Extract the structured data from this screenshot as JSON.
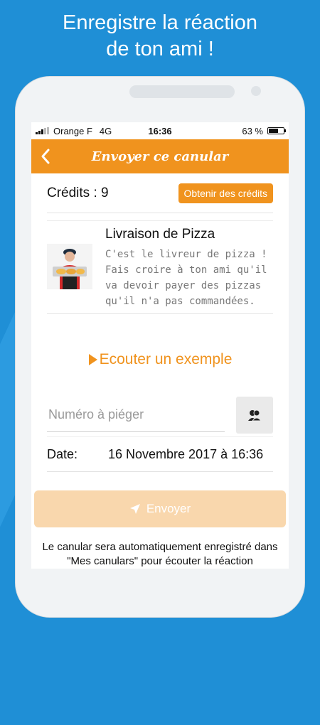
{
  "headline": {
    "line1": "Enregistre la réaction",
    "line2": "de ton ami !"
  },
  "status_bar": {
    "carrier": "Orange F",
    "network": "4G",
    "time": "16:36",
    "battery_text": "63 %",
    "battery_level": 0.63
  },
  "header": {
    "title": "Envoyer ce canular",
    "back_icon": "chevron-left-icon"
  },
  "credits": {
    "label": "Crédits : 9",
    "button_label": "Obtenir des crédits"
  },
  "prank": {
    "title": "Livraison de Pizza",
    "description": "C'est le livreur de pizza ! Fais croire à ton ami qu'il va devoir payer des pizzas qu'il n'a pas commandées.",
    "thumbnail_icon": "pizza-delivery-man-image"
  },
  "listen": {
    "label": "Ecouter un exemple",
    "icon": "play-icon"
  },
  "phone_field": {
    "placeholder": "Numéro à piéger",
    "value": "",
    "contact_icon": "contacts-icon"
  },
  "date": {
    "label": "Date:",
    "value": "16 Novembre 2017 à 16:36"
  },
  "send_button": {
    "label": "Envoyer",
    "icon": "send-icon"
  },
  "note": {
    "text": "Le canular sera automatiquement enregistré dans \"Mes canulars\" pour écouter la réaction"
  },
  "colors": {
    "accent": "#f0931e",
    "background": "#1f8fd6",
    "send_disabled": "#f9d7ad"
  }
}
